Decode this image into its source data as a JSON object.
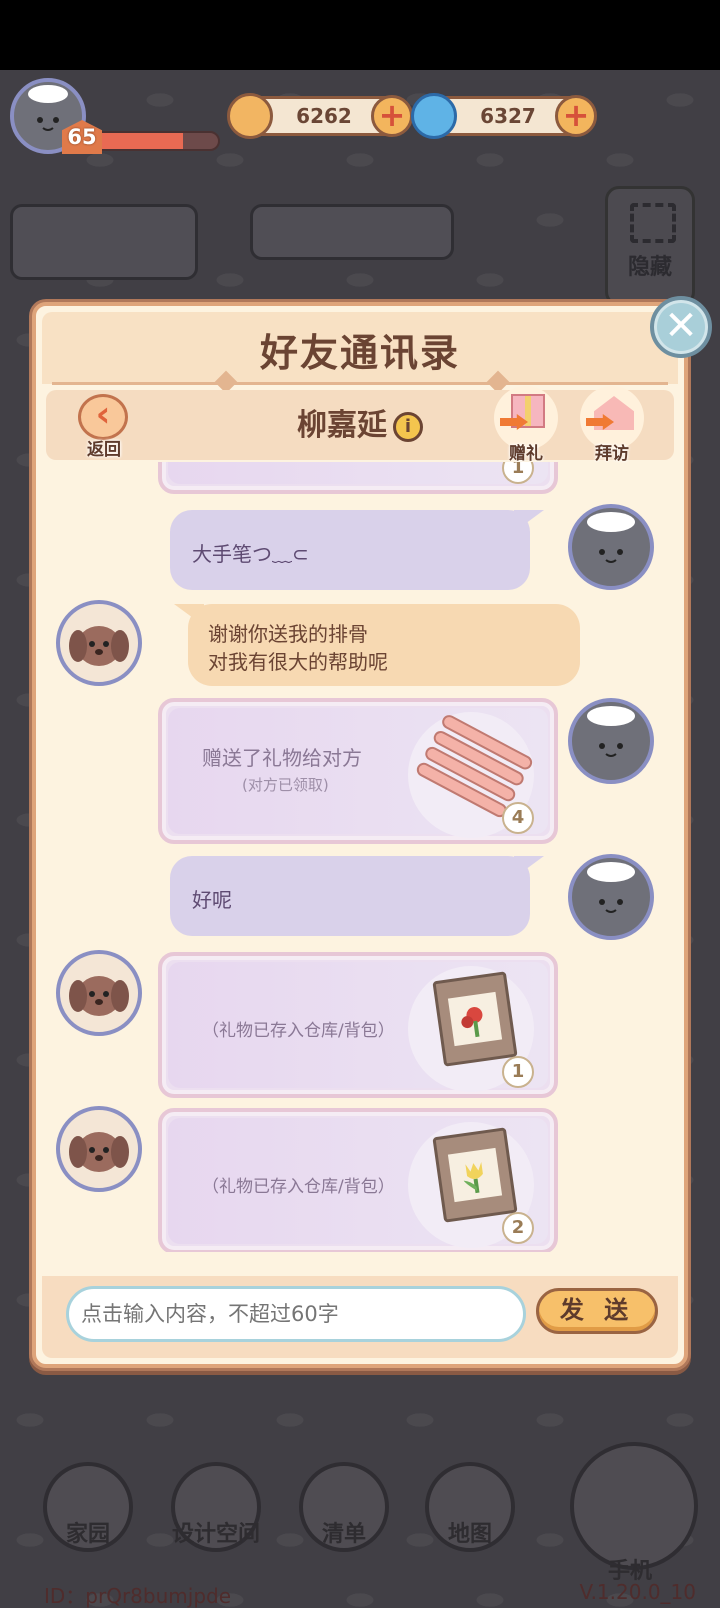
{
  "hud": {
    "level": "65",
    "xp_progress": 0.72,
    "currency1": "6262",
    "currency2": "6327",
    "plus": "+",
    "hide_label": "隐藏"
  },
  "dialog": {
    "title": "好友通讯录",
    "close": "✕",
    "back_label": "返回",
    "back_arrow": "‹",
    "friend_name": "柳嘉延",
    "info": "i",
    "gift_label": "赠礼",
    "visit_label": "拜访"
  },
  "messages": {
    "partial_count": "1",
    "msg1": "大手笔つ﹏⊂",
    "msg2_line1": "谢谢你送我的排骨",
    "msg2_line2": "对我有很大的帮助呢",
    "gift_sent": "赠送了礼物给对方",
    "gift_sent_sub": "(对方已领取)",
    "gift_sent_count": "4",
    "msg3": "好呢",
    "gift_recv1": "（礼物已存入仓库/背包）",
    "gift_recv1_count": "1",
    "gift_recv2": "（礼物已存入仓库/背包）",
    "gift_recv2_count": "2"
  },
  "input": {
    "placeholder": "点击输入内容，不超过60字",
    "send": "发 送"
  },
  "nav": {
    "home": "家园",
    "design": "设计空间",
    "list": "清单",
    "map": "地图",
    "phone": "手机"
  },
  "footer": {
    "id": "ID：prQr8bumjpde",
    "version": "V.1.20.0_10"
  },
  "colors": {
    "dialog_bg": "#fdf3e0",
    "mine_bubble": "#d9d1ea",
    "theirs_bubble": "#f7d9b2",
    "accent": "#f7c06a"
  }
}
